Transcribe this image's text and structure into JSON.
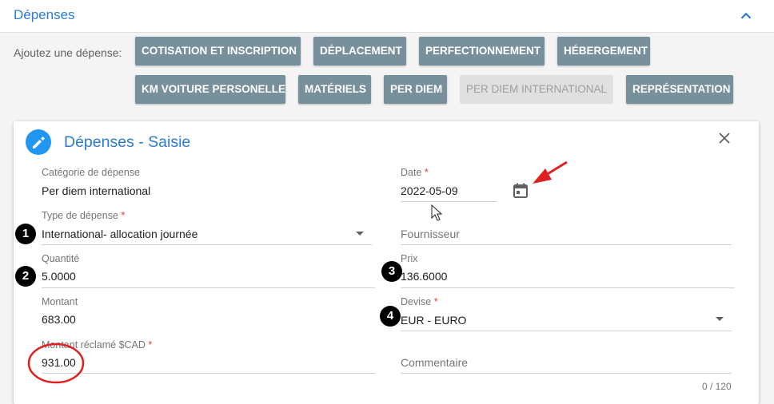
{
  "section": {
    "title": "Dépenses"
  },
  "add_expense": {
    "label": "Ajoutez une dépense:",
    "buttons": [
      "COTISATION ET INSCRIPTION",
      "DÉPLACEMENT",
      "PERFECTIONNEMENT",
      "HÉBERGEMENT",
      "KM VOITURE PERSONELLE",
      "MATÉRIELS",
      "PER DIEM",
      "PER DIEM INTERNATIONAL",
      "REPRÉSENTATION"
    ],
    "disabled_button": "PER DIEM INTERNATIONAL"
  },
  "form": {
    "title": "Dépenses - Saisie",
    "category": {
      "label": "Catégorie de dépense",
      "value": "Per diem international"
    },
    "date": {
      "label": "Date",
      "value": "2022-05-09"
    },
    "type": {
      "label": "Type de dépense",
      "value": "International- allocation journée"
    },
    "supplier": {
      "placeholder": "Fournisseur"
    },
    "quantity": {
      "label": "Quantité",
      "value": "5.0000"
    },
    "price": {
      "label": "Prix",
      "value": "136.6000"
    },
    "amount": {
      "label": "Montant",
      "value": "683.00"
    },
    "currency": {
      "label": "Devise",
      "value": "EUR - EURO"
    },
    "claimed": {
      "label": "Montant réclamé $CAD",
      "value": "931.00"
    },
    "comment": {
      "placeholder": "Commentaire",
      "counter": "0 / 120"
    },
    "required_mark": "*"
  },
  "annotations": {
    "badges": [
      "1",
      "2",
      "3",
      "4"
    ],
    "colors": {
      "accent": "#2b7bd0",
      "button": "#78909c",
      "annotation_red": "#e02020"
    }
  }
}
